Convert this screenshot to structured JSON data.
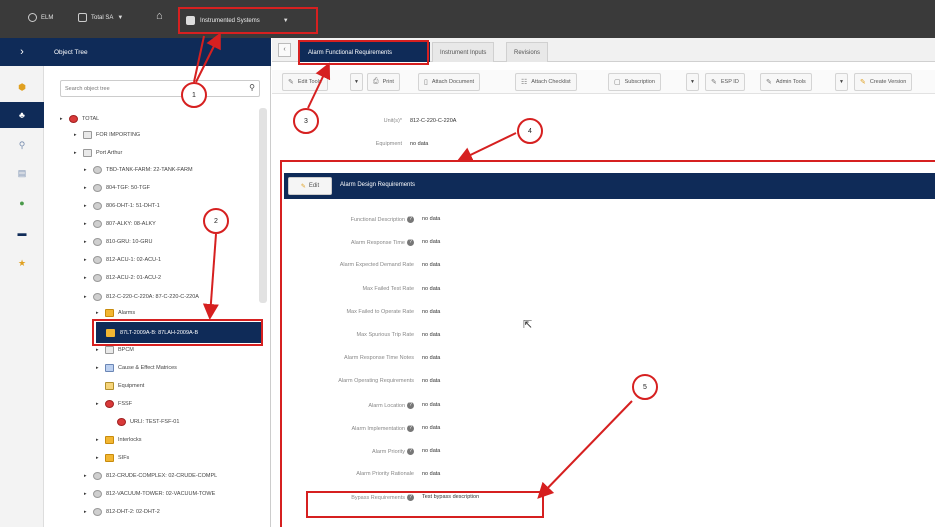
{
  "topbar": {
    "items": [
      {
        "label": "ELM",
        "icon": "cloud-icon"
      },
      {
        "label": "Total SA",
        "icon": "database-icon"
      }
    ],
    "plant_selector": "Instrumented Systems"
  },
  "sidebar_icons": [
    "expand-icon",
    "cube-icon",
    "hierarchy-icon",
    "search-icon",
    "report-icon",
    "globe-icon",
    "minus-icon",
    "star-icon"
  ],
  "tree": {
    "header": "Object Tree",
    "search_placeholder": "Search object tree",
    "nodes": [
      {
        "label": "TOTAL",
        "level": 0,
        "icon": "red"
      },
      {
        "label": "FOR IMPORTING",
        "level": 1,
        "icon": "sq"
      },
      {
        "label": "Port Arthur",
        "level": 1,
        "icon": "sq"
      },
      {
        "label": "TBD-TANK-FARM: 22-TANK-FARM",
        "level": 2,
        "icon": "round"
      },
      {
        "label": "804-TGF: 50-TGF",
        "level": 2,
        "icon": "round"
      },
      {
        "label": "806-DHT-1: 51-DHT-1",
        "level": 2,
        "icon": "round"
      },
      {
        "label": "807-ALKY: 08-ALKY",
        "level": 2,
        "icon": "round"
      },
      {
        "label": "810-GRU: 10-GRU",
        "level": 2,
        "icon": "round"
      },
      {
        "label": "812-ACU-1: 02-ACU-1",
        "level": 2,
        "icon": "round"
      },
      {
        "label": "812-ACU-2: 01-ACU-2",
        "level": 2,
        "icon": "round"
      },
      {
        "label": "812-C-220-C-220A: 87-C-220-C-220A",
        "level": 2,
        "icon": "round"
      },
      {
        "label": "Alarms",
        "level": 3,
        "icon": "yel"
      },
      {
        "label": "BPCM",
        "level": 3,
        "icon": "sq"
      },
      {
        "label": "Cause & Effect Matrices",
        "level": 3,
        "icon": "blue"
      },
      {
        "label": "Equipment",
        "level": 3,
        "icon": "tool"
      },
      {
        "label": "FSSF",
        "level": 3,
        "icon": "red"
      },
      {
        "label": "URLI: TEST-FSF-01",
        "level": 4,
        "icon": "red"
      },
      {
        "label": "Interlocks",
        "level": 3,
        "icon": "yel"
      },
      {
        "label": "SIFs",
        "level": 3,
        "icon": "yel"
      },
      {
        "label": "812-CRUDE-COMPLEX: 02-CRUDE-COMPL",
        "level": 2,
        "icon": "round"
      },
      {
        "label": "812-VACUUM-TOWER: 02-VACUUM-TOWE",
        "level": 2,
        "icon": "round"
      },
      {
        "label": "812-DHT-2: 02-DHT-2",
        "level": 2,
        "icon": "round"
      }
    ],
    "selected_node": "87LT-2009A-B: 87LAH-2009A-B"
  },
  "tabs": [
    {
      "label": "Alarm Functional Requirements",
      "active": true
    },
    {
      "label": "Instrument Inputs",
      "active": false
    },
    {
      "label": "Revisions",
      "active": false
    }
  ],
  "toolbar": {
    "edit_tools": "Edit Tools",
    "print": "Print",
    "attach_document": "Attach Document",
    "attach_checklist": "Attach Checklist",
    "subscription": "Subscription",
    "esp_id": "ESP ID",
    "admin_tools": "Admin Tools",
    "create_version": "Create Version"
  },
  "header_fields": [
    {
      "label": "Unit(s)*",
      "value": "812-C-220-C-220A"
    },
    {
      "label": "Equipment",
      "value": "no data"
    }
  ],
  "section": {
    "edit_label": "Edit",
    "title": "Alarm Design Requirements",
    "fields": [
      {
        "label": "Functional Description",
        "value": "no data",
        "info": true
      },
      {
        "label": "Alarm Response Time",
        "value": "no data",
        "info": true
      },
      {
        "label": "Alarm Expected Demand Rate",
        "value": "no data",
        "info": false
      },
      {
        "label": "Max Failed Test Rate",
        "value": "no data",
        "info": false
      },
      {
        "label": "Max Failed to Operate Rate",
        "value": "no data",
        "info": false
      },
      {
        "label": "Max Spurious Trip Rate",
        "value": "no data",
        "info": false
      },
      {
        "label": "Alarm Response Time Notes",
        "value": "no data",
        "info": false
      },
      {
        "label": "Alarm Operating Requirements",
        "value": "no data",
        "info": false
      },
      {
        "label": "Alarm Location",
        "value": "no data",
        "info": true
      },
      {
        "label": "Alarm Implementation",
        "value": "no data",
        "info": true
      },
      {
        "label": "Alarm Priority",
        "value": "no data",
        "info": true
      },
      {
        "label": "Alarm Priority Rationale",
        "value": "no data",
        "info": false
      },
      {
        "label": "Bypass Requirements",
        "value": "Test bypass description",
        "info": true
      }
    ]
  },
  "callouts": [
    "1",
    "2",
    "3",
    "4",
    "5"
  ],
  "colors": {
    "navy": "#0f2b58",
    "annotation_red": "#d62020",
    "topbar": "#3a3a3a"
  }
}
